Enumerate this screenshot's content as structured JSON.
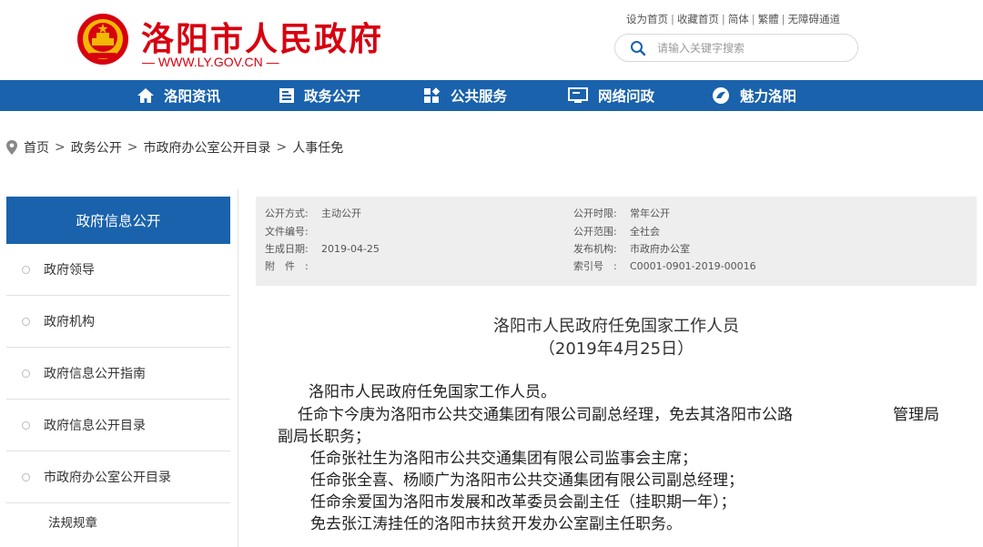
{
  "header": {
    "site_title": "洛阳市人民政府",
    "site_url": "— WWW.LY.GOV.CN —",
    "top_links": [
      "设为首页",
      "收藏首页",
      "简体",
      "繁體",
      "无障碍通道"
    ],
    "search_placeholder": "请输入关键字搜索"
  },
  "nav": {
    "items": [
      {
        "label": "洛阳资讯",
        "icon": "home-icon"
      },
      {
        "label": "政务公开",
        "icon": "document-icon"
      },
      {
        "label": "公共服务",
        "icon": "services-icon"
      },
      {
        "label": "网络问政",
        "icon": "monitor-icon"
      },
      {
        "label": "魅力洛阳",
        "icon": "leaf-icon"
      }
    ]
  },
  "breadcrumb": [
    "首页",
    "政务公开",
    "市政府办公室公开目录",
    "人事任免"
  ],
  "sidebar": {
    "title": "政府信息公开",
    "items": [
      "政府领导",
      "政府机构",
      "政府信息公开指南",
      "政府信息公开目录",
      "市政府办公室公开目录"
    ],
    "sub_item": "法规规章"
  },
  "info": {
    "left": [
      {
        "label": "公开方式:",
        "value": "主动公开"
      },
      {
        "label": "文件编号:",
        "value": ""
      },
      {
        "label": "生成日期:",
        "value": "2019-04-25"
      },
      {
        "label": "附　件　:",
        "value": ""
      }
    ],
    "right": [
      {
        "label": "公开时限:",
        "value": "常年公开"
      },
      {
        "label": "公开范围:",
        "value": "全社会"
      },
      {
        "label": "发布机构:",
        "value": "市政府办公室"
      },
      {
        "label": "索引号　:",
        "value": "C0001-0901-2019-00016"
      }
    ]
  },
  "document": {
    "title": "洛阳市人民政府任免国家工作人员",
    "date": "（2019年4月25日）",
    "paragraphs": [
      "洛阳市人民政府任免国家工作人员。",
      "任命卞今庚为洛阳市公共交通集团有限公司副总经理，免去其洛阳市公路",
      "管理局",
      "副局长职务；",
      "任命张社生为洛阳市公共交通集团有限公司监事会主席；",
      "任命张全喜、杨顺广为洛阳市公共交通集团有限公司副总经理；",
      "任命余爱国为洛阳市发展和改革委员会副主任（挂职期一年）；",
      "免去张江涛挂任的洛阳市扶贫开发办公室副主任职务。"
    ]
  },
  "colors": {
    "brand_red": "#d7000f",
    "nav_blue": "#1a62ac",
    "info_bg": "#eeeeee"
  }
}
